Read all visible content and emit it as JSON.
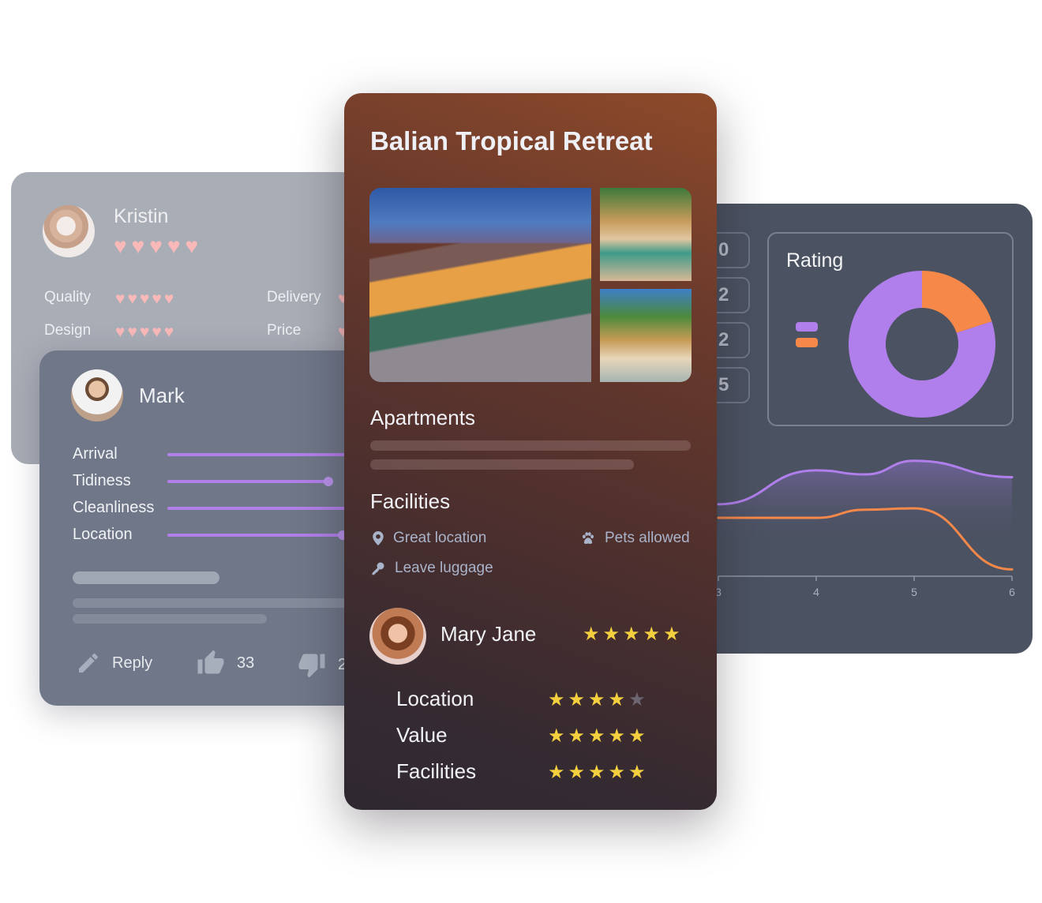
{
  "kristin_card": {
    "name": "Kristin",
    "overall_hearts": 5,
    "criteria": [
      {
        "label": "Quality",
        "hearts": 5
      },
      {
        "label": "Design",
        "hearts": 5
      },
      {
        "label": "Delivery",
        "hearts": 5
      },
      {
        "label": "Price",
        "hearts": 5
      }
    ],
    "heart_color": "#f9b9b9"
  },
  "mark_card": {
    "name": "Mark",
    "sliders": [
      {
        "label": "Arrival"
      },
      {
        "label": "Tidiness"
      },
      {
        "label": "Cleanliness"
      },
      {
        "label": "Location"
      }
    ],
    "slider_color": "#b17fe8",
    "actions": {
      "reply_label": "Reply",
      "likes": "33",
      "dislikes": "2"
    }
  },
  "hotel_card": {
    "title": "Balian Tropical Retreat",
    "apartments_title": "Apartments",
    "facilities_title": "Facilities",
    "facilities": [
      {
        "icon": "map-pin-icon",
        "label": "Great location"
      },
      {
        "icon": "paw-icon",
        "label": "Pets allowed"
      },
      {
        "icon": "key-icon",
        "label": "Leave luggage"
      }
    ],
    "review": {
      "reviewer": "Mary Jane",
      "overall_stars": 5,
      "ratings": [
        {
          "label": "Location",
          "stars": 4
        },
        {
          "label": "Value",
          "stars": 5
        },
        {
          "label": "Facilities",
          "stars": 5
        }
      ]
    },
    "star_color": "#f4d03f"
  },
  "dashboard_card": {
    "number_boxes": [
      "0",
      "2",
      "2",
      "5"
    ],
    "rating_title": "Rating"
  },
  "chart_data": [
    {
      "type": "pie",
      "title": "Rating",
      "donut": true,
      "series": [
        {
          "name": "orange",
          "value": 20,
          "color": "#f6884a"
        },
        {
          "name": "purple",
          "value": 80,
          "color": "#b07fec"
        }
      ],
      "legend": "left"
    },
    {
      "type": "area",
      "x": [
        3,
        4,
        4.5,
        5,
        6
      ],
      "xticks": [
        "3",
        "4",
        "5",
        "6"
      ],
      "xlim": [
        3,
        6
      ],
      "ylim": [
        0,
        10
      ],
      "series": [
        {
          "name": "purple",
          "color": "#b07fec",
          "values": [
            5.3,
            7.8,
            7.5,
            8.5,
            7.3
          ],
          "filled": true
        },
        {
          "name": "orange",
          "color": "#f6884a",
          "values": [
            4.3,
            4.3,
            4.9,
            5.0,
            0.5
          ],
          "filled": false
        }
      ]
    }
  ]
}
